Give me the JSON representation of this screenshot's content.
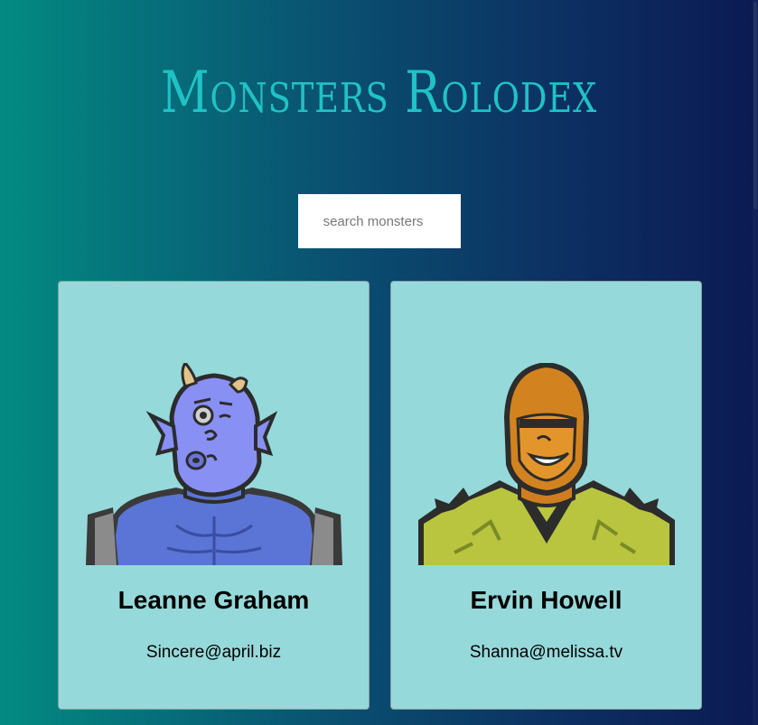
{
  "app": {
    "title": "Monsters Rolodex"
  },
  "search": {
    "placeholder": "search monsters",
    "value": ""
  },
  "monsters": [
    {
      "name": "Leanne Graham",
      "email": "Sincere@april.biz",
      "avatar_icon": "blue-horned-monster-avatar",
      "skin_color": "#7f8cf0"
    },
    {
      "name": "Ervin Howell",
      "email": "Shanna@melissa.tv",
      "avatar_icon": "orange-hooded-monster-avatar",
      "skin_color": "#e08a25"
    }
  ],
  "colors": {
    "title": "#1fc2c6",
    "card_background": "#96d9da",
    "gradient_left": "#038a82",
    "gradient_right": "#0b1a52"
  }
}
